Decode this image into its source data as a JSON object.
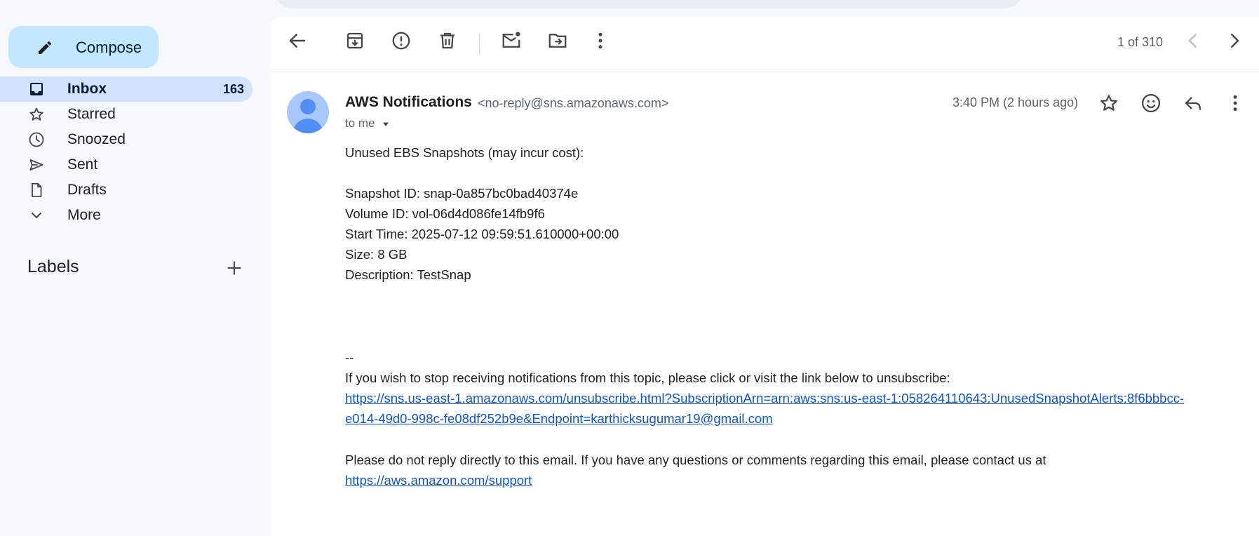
{
  "sidebar": {
    "compose_label": "Compose",
    "items": [
      {
        "label": "Inbox",
        "count": "163",
        "icon": "inbox-icon"
      },
      {
        "label": "Starred",
        "icon": "star-icon"
      },
      {
        "label": "Snoozed",
        "icon": "clock-icon"
      },
      {
        "label": "Sent",
        "icon": "send-icon"
      },
      {
        "label": "Drafts",
        "icon": "draft-icon"
      },
      {
        "label": "More",
        "icon": "chevron-down-icon"
      }
    ],
    "labels_heading": "Labels"
  },
  "toolbar": {
    "pager": "1 of 310",
    "icons": [
      "back-arrow-icon",
      "archive-icon",
      "report-spam-icon",
      "delete-icon",
      "mark-unread-icon",
      "move-to-icon",
      "more-vert-icon",
      "prev-icon",
      "next-icon"
    ]
  },
  "message": {
    "sender_name": "AWS Notifications",
    "sender_email": "<no-reply@sns.amazonaws.com>",
    "recipient": "to me",
    "time": "3:40 PM (2 hours ago)",
    "body": {
      "heading": "Unused EBS Snapshots (may incur cost):",
      "snapshot_id": "Snapshot ID: snap-0a857bc0bad40374e",
      "volume_id": "Volume ID: vol-06d4d086fe14fb9f6",
      "start_time": "Start Time: 2025-07-12 09:59:51.610000+00:00",
      "size": "Size: 8 GB",
      "description": "Description: TestSnap",
      "signature_sep": "--",
      "unsubscribe_text": "If you wish to stop receiving notifications from this topic, please click or visit the link below to unsubscribe:",
      "unsubscribe_link_1": "https://sns.us-east-1.amazonaws.com/unsubscribe.html?SubscriptionArn=arn:aws:sns:us-east-1:058264110643:UnusedSnapshotAlerts:8f6bbbcc-",
      "unsubscribe_link_2": "e014-49d0-998c-fe08df252b9e&Endpoint=karthicksugumar19@gmail.com",
      "no_reply_text": "Please do not reply directly to this email. If you have any questions or comments regarding this email, please contact us at",
      "support_link": "https://aws.amazon.com/support"
    }
  },
  "colors": {
    "background": "#f6f8fc",
    "compose": "#c2e7ff",
    "active_nav": "#d3e3fd",
    "link": "#1155cc",
    "avatar": "#a8c7fa"
  }
}
